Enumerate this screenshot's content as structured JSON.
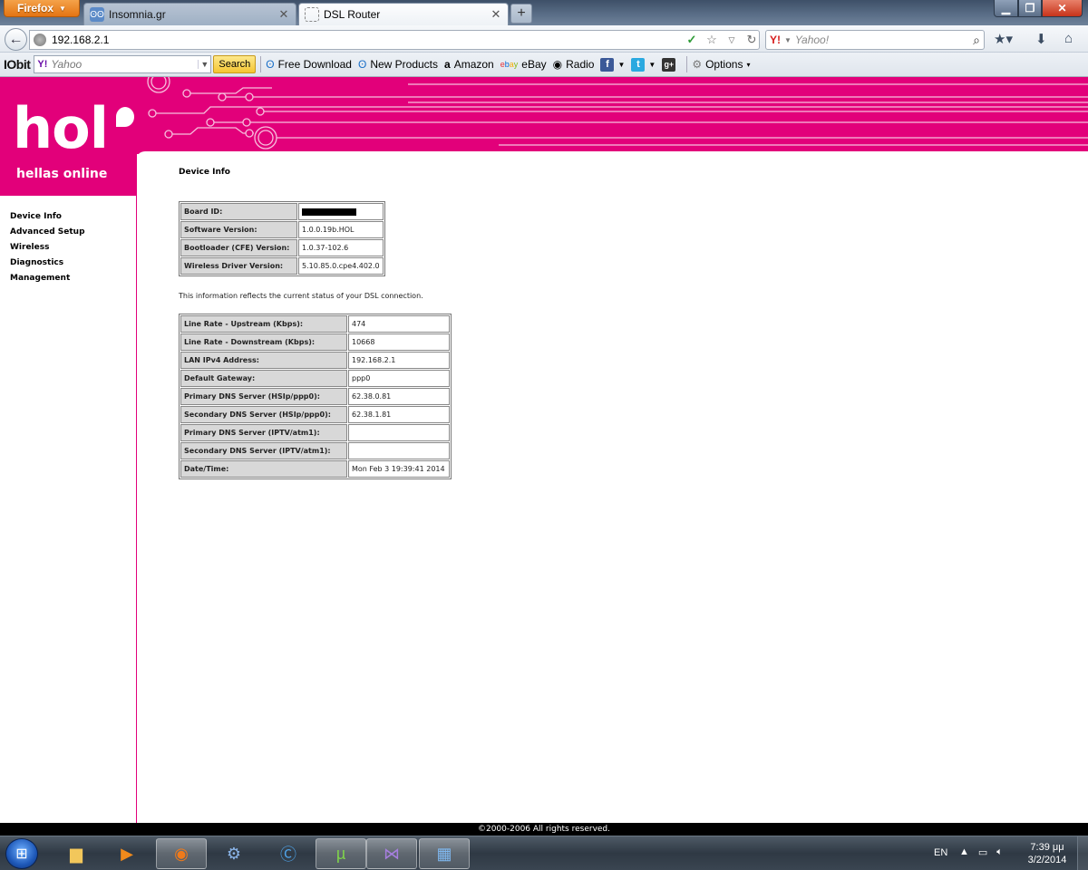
{
  "browser": {
    "app_button": "Firefox",
    "tabs": [
      {
        "label": "Insomnia.gr",
        "active": false
      },
      {
        "label": "DSL Router",
        "active": true
      }
    ],
    "url": "192.168.2.1",
    "search_placeholder": "Yahoo!",
    "search_engine_logo": "Y!"
  },
  "toolbar": {
    "brand": "IObit",
    "search_logo": "Y!",
    "search_text": "Yahoo",
    "search_button": "Search",
    "items": [
      {
        "label": "Free Download",
        "icon": "ring-icon"
      },
      {
        "label": "New Products",
        "icon": "ring-icon"
      },
      {
        "label": "Amazon",
        "icon": "amazon-icon"
      },
      {
        "label": "eBay",
        "icon": "ebay-icon"
      },
      {
        "label": "Radio",
        "icon": "radio-icon"
      }
    ],
    "options": "Options"
  },
  "router": {
    "logo_text": "hol",
    "logo_subtitle": "hellas online",
    "menu": [
      "Device Info",
      "Advanced Setup",
      "Wireless",
      "Diagnostics",
      "Management"
    ],
    "page_title": "Device Info",
    "device_info": [
      {
        "label": "Board ID:",
        "value": ""
      },
      {
        "label": "Software Version:",
        "value": "1.0.0.19b.HOL"
      },
      {
        "label": "Bootloader (CFE) Version:",
        "value": "1.0.37-102.6"
      },
      {
        "label": "Wireless Driver Version:",
        "value": "5.10.85.0.cpe4.402.0"
      }
    ],
    "dsl_note": "This information reflects the current status of your DSL connection.",
    "dsl_info": [
      {
        "label": "Line Rate - Upstream (Kbps):",
        "value": "474"
      },
      {
        "label": "Line Rate - Downstream (Kbps):",
        "value": "10668"
      },
      {
        "label": "LAN IPv4 Address:",
        "value": "192.168.2.1"
      },
      {
        "label": "Default Gateway:",
        "value": "ppp0"
      },
      {
        "label": "Primary DNS Server  (HSIp/ppp0):",
        "value": "62.38.0.81"
      },
      {
        "label": "Secondary DNS Server  (HSIp/ppp0):",
        "value": "62.38.1.81"
      },
      {
        "label": "Primary DNS Server  (IPTV/atm1):",
        "value": ""
      },
      {
        "label": "Secondary DNS Server  (IPTV/atm1):",
        "value": ""
      },
      {
        "label": "Date/Time:",
        "value": "Mon Feb 3 19:39:41 2014"
      }
    ],
    "footer": "©2000-2006 All rights reserved."
  },
  "taskbar": {
    "language": "EN",
    "time": "7:39 μμ",
    "date": "3/2/2014"
  },
  "colors": {
    "brand_pink": "#e2007a",
    "label_bg": "#d8d8d8"
  }
}
